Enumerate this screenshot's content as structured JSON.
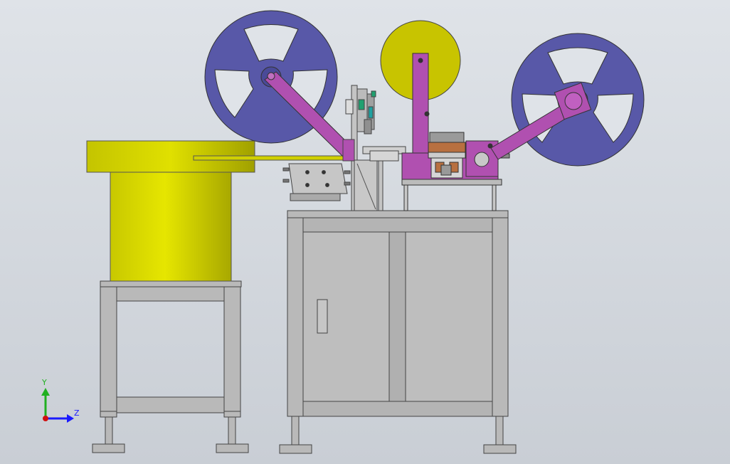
{
  "viewport": {
    "background_top": "#dfe3e8",
    "background_bottom": "#c9ced5"
  },
  "triad": {
    "y_label": "Y",
    "z_label": "Z",
    "y_color": "#20b020",
    "z_color": "#1a1aff",
    "origin_color": "#d01010"
  },
  "colors": {
    "frame_gray": "#b9b9b9",
    "frame_edge": "#444444",
    "feeder_yellow": "#d8d800",
    "reel_blue": "#5858a8",
    "reel_olive": "#c8c400",
    "arm_magenta": "#b050b0",
    "copper": "#b87040",
    "accent_green": "#20a070",
    "accent_cyan": "#20a0a0"
  }
}
